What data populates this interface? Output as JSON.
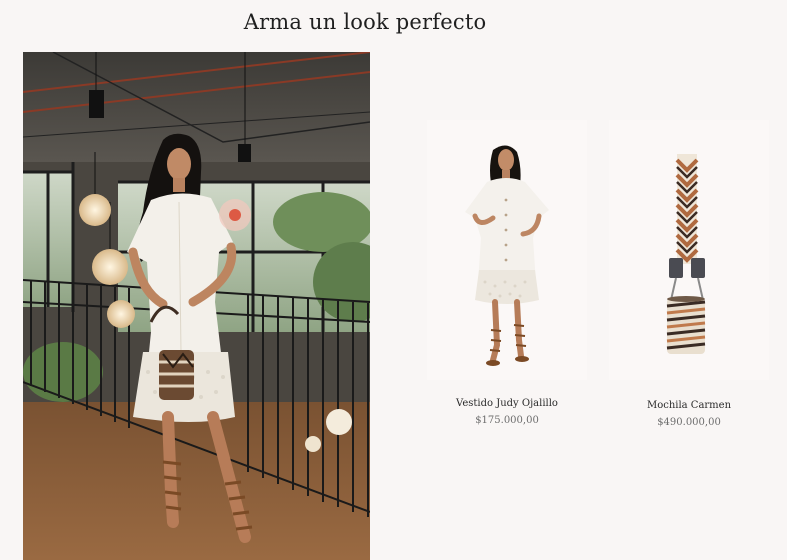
{
  "section": {
    "title": "Arma un look perfecto"
  },
  "hero": {
    "photo_icon": "woman-in-white-dress-lifestyle-photo",
    "hotspot_icon": "product-hotspot-dot",
    "accent_color": "#dd5a44"
  },
  "products": [
    {
      "name": "Vestido Judy Ojalillo",
      "price": "$175.000,00",
      "image_icon": "white-dress-model-photo"
    },
    {
      "name": "Mochila Carmen",
      "price": "$490.000,00",
      "image_icon": "woven-bucket-bag-photo"
    }
  ]
}
